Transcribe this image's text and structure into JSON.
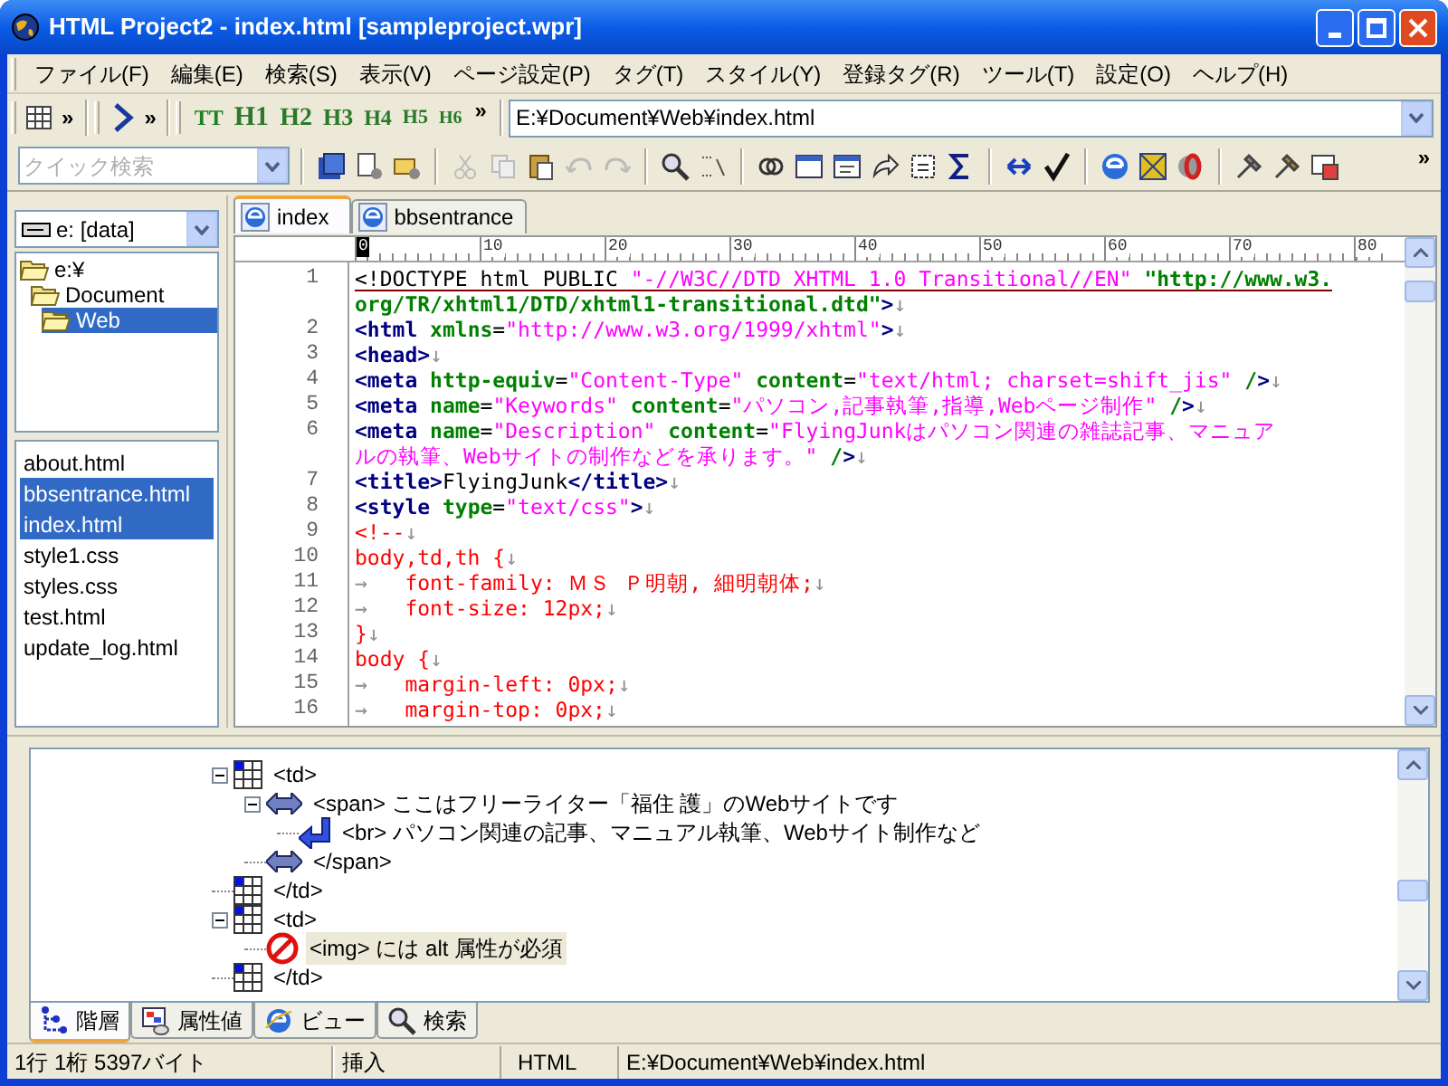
{
  "window": {
    "title": "HTML Project2 - index.html [sampleproject.wpr]"
  },
  "menu": [
    "ファイル(F)",
    "編集(E)",
    "検索(S)",
    "表示(V)",
    "ページ設定(P)",
    "タグ(T)",
    "スタイル(Y)",
    "登録タグ(R)",
    "ツール(T)",
    "設定(O)",
    "ヘルプ(H)"
  ],
  "toolbar": {
    "chevrons": [
      "»",
      "»",
      "»",
      "»"
    ],
    "text_button": "TT",
    "heading_buttons": [
      "H1",
      "H2",
      "H3",
      "H4",
      "H5",
      "H6"
    ],
    "path_field": "E:¥Document¥Web¥index.html"
  },
  "quick_search": {
    "placeholder": "クイック検索"
  },
  "drive": "e: [data]",
  "folders": [
    {
      "name": "e:¥",
      "selected": false,
      "children": [
        {
          "name": "Document",
          "selected": false,
          "children": [
            {
              "name": "Web",
              "selected": true
            }
          ]
        }
      ]
    }
  ],
  "files": [
    {
      "name": "about.html",
      "selected": false
    },
    {
      "name": "bbsentrance.html",
      "selected": true
    },
    {
      "name": "index.html",
      "selected": true
    },
    {
      "name": "style1.css",
      "selected": false
    },
    {
      "name": "styles.css",
      "selected": false
    },
    {
      "name": "test.html",
      "selected": false
    },
    {
      "name": "update_log.html",
      "selected": false
    }
  ],
  "editor_tabs": [
    {
      "label": "index",
      "selected": true
    },
    {
      "label": "bbsentrance",
      "selected": false
    }
  ],
  "ruler": [
    "0",
    "10",
    "20",
    "30",
    "40",
    "50",
    "60",
    "70",
    "80"
  ],
  "code_lines": [
    {
      "num": "1",
      "current": true,
      "segments": [
        {
          "kind": "plain",
          "text": "<!DOCTYPE html PUBLIC "
        },
        {
          "kind": "str",
          "text": "\"-//W3C//DTD XHTML 1.0 Transitional//EN\" "
        },
        {
          "kind": "url",
          "text": "\"http://www.w3."
        }
      ]
    },
    {
      "current": false,
      "segments": [
        {
          "kind": "url",
          "text": "org/TR/xhtml1/DTD/xhtml1-transitional.dtd\""
        },
        {
          "kind": "tag",
          "text": ">"
        },
        {
          "kind": "mark",
          "text": "↓"
        }
      ]
    },
    {
      "num": "2",
      "current": false,
      "segments": [
        {
          "kind": "tag",
          "text": "<html "
        },
        {
          "kind": "attr",
          "text": "xmlns"
        },
        {
          "kind": "plain",
          "text": "="
        },
        {
          "kind": "str",
          "text": "\"http://www.w3.org/1999/xhtml\""
        },
        {
          "kind": "tag",
          "text": ">"
        },
        {
          "kind": "mark",
          "text": "↓"
        }
      ]
    },
    {
      "num": "3",
      "current": false,
      "segments": [
        {
          "kind": "tag",
          "text": "<head>"
        },
        {
          "kind": "mark",
          "text": "↓"
        }
      ]
    },
    {
      "num": "4",
      "current": false,
      "segments": [
        {
          "kind": "tag",
          "text": "<meta "
        },
        {
          "kind": "attr",
          "text": "http-equiv"
        },
        {
          "kind": "plain",
          "text": "="
        },
        {
          "kind": "str",
          "text": "\"Content-Type\" "
        },
        {
          "kind": "attr",
          "text": "content"
        },
        {
          "kind": "plain",
          "text": "="
        },
        {
          "kind": "str",
          "text": "\"text/html; charset=shift_jis\" "
        },
        {
          "kind": "attr",
          "text": "/"
        },
        {
          "kind": "tag",
          "text": ">"
        },
        {
          "kind": "mark",
          "text": "↓"
        }
      ]
    },
    {
      "num": "5",
      "current": false,
      "segments": [
        {
          "kind": "tag",
          "text": "<meta "
        },
        {
          "kind": "attr",
          "text": "name"
        },
        {
          "kind": "plain",
          "text": "="
        },
        {
          "kind": "str",
          "text": "\"Keywords\" "
        },
        {
          "kind": "attr",
          "text": "content"
        },
        {
          "kind": "plain",
          "text": "="
        },
        {
          "kind": "str",
          "text": "\"パソコン,記事執筆,指導,Webページ制作\" "
        },
        {
          "kind": "attr",
          "text": "/"
        },
        {
          "kind": "tag",
          "text": ">"
        },
        {
          "kind": "mark",
          "text": "↓"
        }
      ]
    },
    {
      "num": "6",
      "current": false,
      "segments": [
        {
          "kind": "tag",
          "text": "<meta "
        },
        {
          "kind": "attr",
          "text": "name"
        },
        {
          "kind": "plain",
          "text": "="
        },
        {
          "kind": "str",
          "text": "\"Description\" "
        },
        {
          "kind": "attr",
          "text": "content"
        },
        {
          "kind": "plain",
          "text": "="
        },
        {
          "kind": "str",
          "text": "\"FlyingJunkはパソコン関連の雑誌記事、マニュア"
        }
      ]
    },
    {
      "current": false,
      "segments": [
        {
          "kind": "str",
          "text": "ルの執筆、Webサイトの制作などを承ります。\" "
        },
        {
          "kind": "attr",
          "text": "/"
        },
        {
          "kind": "tag",
          "text": ">"
        },
        {
          "kind": "mark",
          "text": "↓"
        }
      ]
    },
    {
      "num": "7",
      "current": false,
      "segments": [
        {
          "kind": "tag",
          "text": "<title>"
        },
        {
          "kind": "plain",
          "text": "FlyingJunk"
        },
        {
          "kind": "tag",
          "text": "</title>"
        },
        {
          "kind": "mark",
          "text": "↓"
        }
      ]
    },
    {
      "num": "8",
      "current": false,
      "segments": [
        {
          "kind": "tag",
          "text": "<style "
        },
        {
          "kind": "attr",
          "text": "type"
        },
        {
          "kind": "plain",
          "text": "="
        },
        {
          "kind": "str",
          "text": "\"text/css\""
        },
        {
          "kind": "tag",
          "text": ">"
        },
        {
          "kind": "mark",
          "text": "↓"
        }
      ]
    },
    {
      "num": "9",
      "current": false,
      "segments": [
        {
          "kind": "css",
          "text": "<!--"
        },
        {
          "kind": "mark",
          "text": "↓"
        }
      ]
    },
    {
      "num": "10",
      "current": false,
      "segments": [
        {
          "kind": "css",
          "text": "body,td,th {"
        },
        {
          "kind": "mark",
          "text": "↓"
        }
      ]
    },
    {
      "num": "11",
      "current": false,
      "segments": [
        {
          "kind": "mark",
          "text": "→   "
        },
        {
          "kind": "css",
          "text": "font-family: ＭＳ Ｐ明朝, 細明朝体;"
        },
        {
          "kind": "mark",
          "text": "↓"
        }
      ]
    },
    {
      "num": "12",
      "current": false,
      "segments": [
        {
          "kind": "mark",
          "text": "→   "
        },
        {
          "kind": "css",
          "text": "font-size: 12px;"
        },
        {
          "kind": "mark",
          "text": "↓"
        }
      ]
    },
    {
      "num": "13",
      "current": false,
      "segments": [
        {
          "kind": "css",
          "text": "}"
        },
        {
          "kind": "mark",
          "text": "↓"
        }
      ]
    },
    {
      "num": "14",
      "current": false,
      "segments": [
        {
          "kind": "css",
          "text": "body {"
        },
        {
          "kind": "mark",
          "text": "↓"
        }
      ]
    },
    {
      "num": "15",
      "current": false,
      "segments": [
        {
          "kind": "mark",
          "text": "→   "
        },
        {
          "kind": "css",
          "text": "margin-left: 0px;"
        },
        {
          "kind": "mark",
          "text": "↓"
        }
      ]
    },
    {
      "num": "16",
      "current": false,
      "segments": [
        {
          "kind": "mark",
          "text": "→   "
        },
        {
          "kind": "css",
          "text": "margin-top: 0px;"
        },
        {
          "kind": "mark",
          "text": "↓"
        }
      ]
    }
  ],
  "outline": [
    {
      "kind": "table",
      "label": "<td>",
      "expanded": true,
      "selected": false,
      "children": [
        {
          "kind": "inline",
          "label": "<span> ここはフリーライター「福住 護」のWebサイトです",
          "expanded": true,
          "selected": false,
          "children": [
            {
              "kind": "break",
              "label": "<br> パソコン関連の記事、マニュアル執筆、Webサイト制作など",
              "selected": false
            }
          ]
        },
        {
          "kind": "inline",
          "label": "</span>",
          "selected": false
        }
      ]
    },
    {
      "kind": "table",
      "label": "</td>",
      "selected": false
    },
    {
      "kind": "table",
      "label": "<td>",
      "expanded": true,
      "selected": false,
      "children": [
        {
          "kind": "error",
          "label": "<img> には alt 属性が必須",
          "selected": true
        }
      ]
    },
    {
      "kind": "table",
      "label": "</td>",
      "selected": false
    }
  ],
  "bottom_tabs": [
    {
      "label": "階層",
      "selected": true
    },
    {
      "label": "属性値",
      "selected": false
    },
    {
      "label": "ビュー",
      "selected": false
    },
    {
      "label": "検索",
      "selected": false
    }
  ],
  "status_bar": [
    "1行 1桁 5397バイト",
    "挿入",
    "HTML",
    "E:¥Document¥Web¥index.html"
  ]
}
